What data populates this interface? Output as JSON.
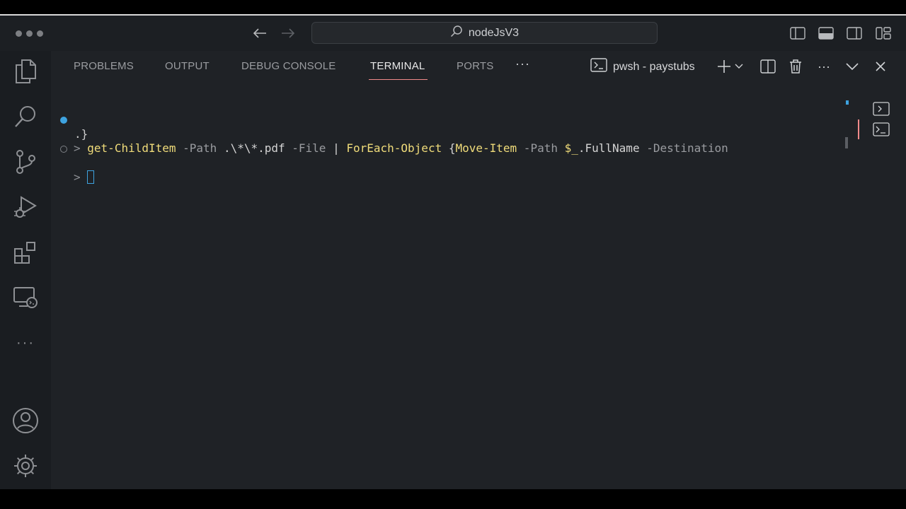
{
  "titlebar": {
    "search_label": "nodeJsV3",
    "icons": [
      "back-arrow-icon",
      "forward-arrow-icon",
      "search-icon",
      "toggle-primary-sidebar-icon",
      "toggle-panel-icon",
      "toggle-secondary-sidebar-icon",
      "customize-layout-icon"
    ]
  },
  "activitybar": {
    "items": [
      "explorer-icon",
      "search-icon",
      "source-control-icon",
      "run-debug-icon",
      "extensions-icon",
      "remote-explorer-icon",
      "more-icon",
      "accounts-icon",
      "manage-gear-icon"
    ],
    "more_label": "···"
  },
  "panel": {
    "tabs": [
      {
        "label": "PROBLEMS",
        "active": false
      },
      {
        "label": "OUTPUT",
        "active": false
      },
      {
        "label": "DEBUG CONSOLE",
        "active": false
      },
      {
        "label": "TERMINAL",
        "active": true
      },
      {
        "label": "PORTS",
        "active": false
      }
    ],
    "more_label": "···",
    "terminal_name": "pwsh - paystubs",
    "actions_more_label": "···"
  },
  "terminal": {
    "prompt": ">",
    "line1": {
      "cmd1": "get-ChildItem",
      "p1": " -Path",
      "a1": " .\\*\\*.pdf",
      "p2": " -File",
      "a2": " | ",
      "cmd2": "ForEach-Object",
      "a3": " {",
      "cmd3": "Move-Item",
      "p3": " -Path",
      "var": " $_",
      "a4": ".FullName",
      "p4": " -Destination"
    },
    "line1_cont": ".}",
    "colors": {
      "command": "#f0dc7a",
      "parameter": "#9a9ca0",
      "success_dot": "#3ea3e0",
      "cursor": "#3ea3e0"
    }
  },
  "accent": {
    "active_tab_underline": "#f08a8a",
    "active_terminal_marker": "#f08a8a"
  }
}
